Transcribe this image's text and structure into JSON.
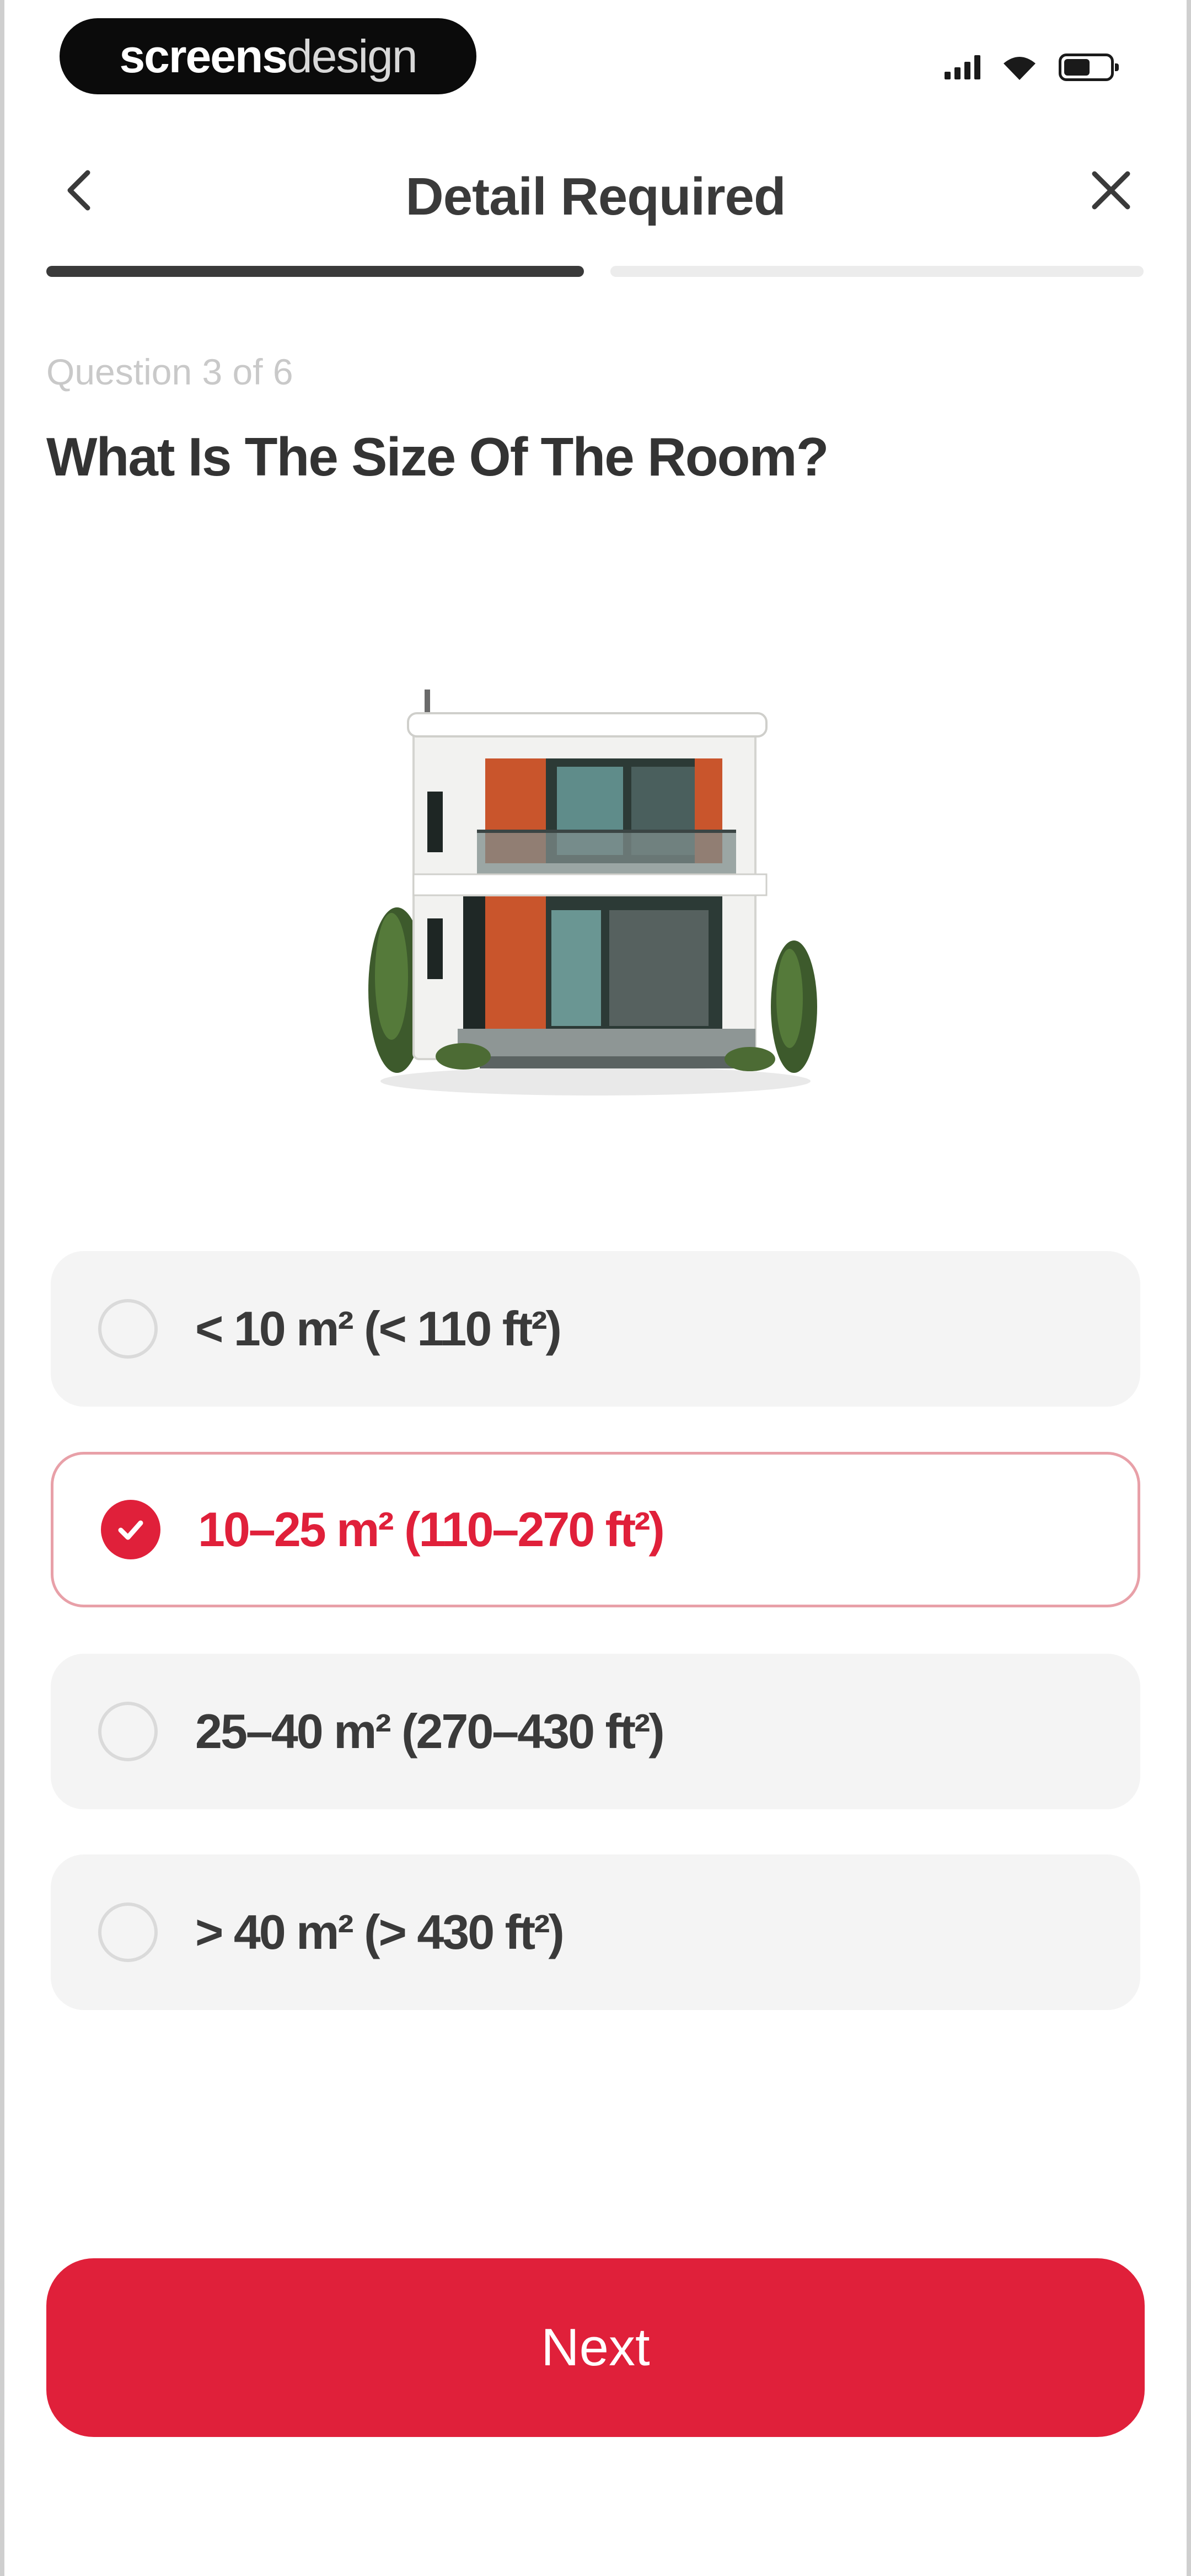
{
  "status_bar": {
    "brand_bold": "screens",
    "brand_light": "design",
    "icons": [
      "signal-icon",
      "wifi-icon",
      "battery-icon"
    ]
  },
  "nav": {
    "title": "Detail Required",
    "back_icon": "chevron-left-icon",
    "close_icon": "close-icon"
  },
  "progress": {
    "completed_fraction": 0.5
  },
  "question": {
    "counter": "Question 3 of 6",
    "title": "What Is The Size Of The Room?"
  },
  "illustration": {
    "icon": "house-illustration"
  },
  "options": [
    {
      "label": "< 10 m² (< 110 ft²)",
      "selected": false
    },
    {
      "label": "10–25 m² (110–270 ft²)",
      "selected": true
    },
    {
      "label": "25–40 m² (270–430 ft²)",
      "selected": false
    },
    {
      "label": "> 40 m² (> 430 ft²)",
      "selected": false
    }
  ],
  "actions": {
    "next_label": "Next"
  },
  "colors": {
    "accent": "#e0203a",
    "selected_border": "#e8a0a8",
    "option_bg": "#f4f4f4",
    "text_dark": "#3a3a3a",
    "text_muted": "#c9c9c9"
  }
}
